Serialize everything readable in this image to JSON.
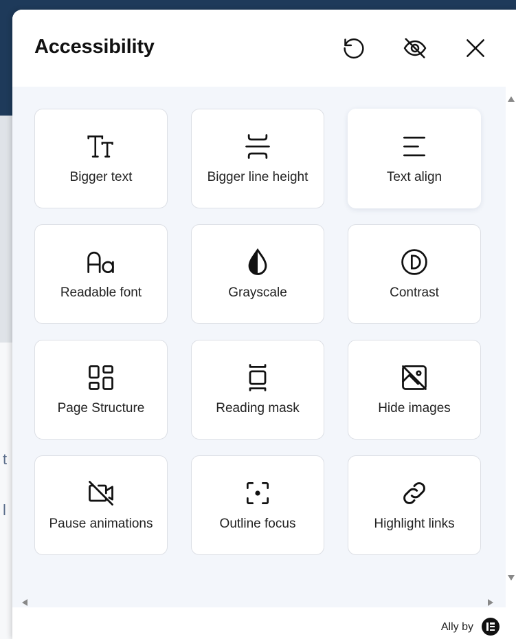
{
  "background": {
    "fragments": [
      "t",
      "",
      "l"
    ]
  },
  "panel": {
    "title": "Accessibility",
    "reset_icon": "reset-icon",
    "hide_icon": "eye-off-icon",
    "close_icon": "close-icon"
  },
  "tiles": [
    {
      "label": "Bigger text",
      "icon": "text-size-icon"
    },
    {
      "label": "Bigger line height",
      "icon": "line-height-icon"
    },
    {
      "label": "Text align",
      "icon": "align-left-icon"
    },
    {
      "label": "Readable font",
      "icon": "font-icon"
    },
    {
      "label": "Grayscale",
      "icon": "droplet-half-icon"
    },
    {
      "label": "Contrast",
      "icon": "contrast-icon"
    },
    {
      "label": "Page Structure",
      "icon": "layout-icon"
    },
    {
      "label": "Reading mask",
      "icon": "reading-mask-icon"
    },
    {
      "label": "Hide images",
      "icon": "image-off-icon"
    },
    {
      "label": "Pause animations",
      "icon": "video-off-icon"
    },
    {
      "label": "Outline focus",
      "icon": "focus-icon"
    },
    {
      "label": "Highlight links",
      "icon": "link-icon"
    }
  ],
  "footer": {
    "credit": "Ally by",
    "logo_icon": "elementor-logo-icon"
  },
  "colors": {
    "header_bg": "#1e3a5a",
    "content_bg": "#f3f6fb",
    "card_border": "#dcdfe5",
    "text": "#222222"
  }
}
